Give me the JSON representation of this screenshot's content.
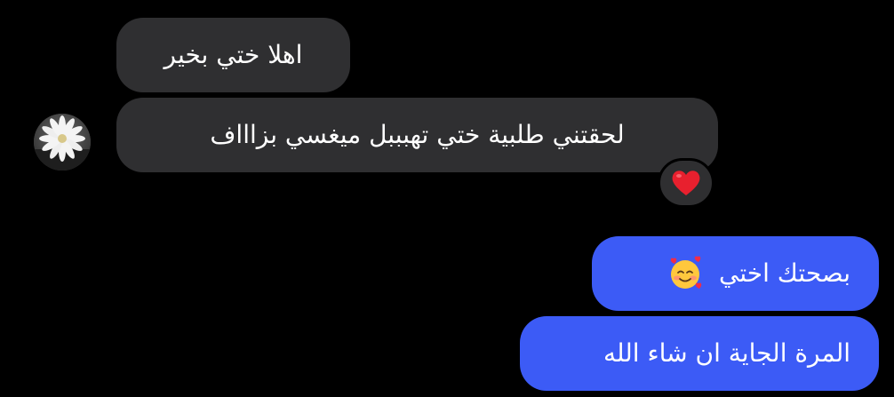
{
  "conversation": {
    "incoming": [
      {
        "text": "اهلا ختي بخير"
      },
      {
        "text": "لحقتني طلبية ختي تهبببل  ميغسي بزاااف",
        "reaction": "red-heart-icon"
      }
    ],
    "outgoing": [
      {
        "text": "بصحتك اختي",
        "emoji": "smiling-face-with-hearts-icon"
      },
      {
        "text": "المرة الجاية ان شاء الله"
      }
    ]
  },
  "avatar": {
    "icon": "daisy-flower-avatar"
  },
  "colors": {
    "background": "#000000",
    "incoming_bubble": "#2f2f31",
    "outgoing_bubble": "#3c5bf6",
    "text": "#ffffff"
  }
}
